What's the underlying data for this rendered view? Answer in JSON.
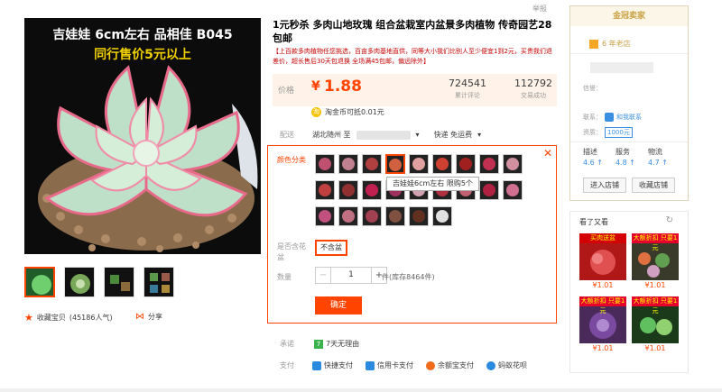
{
  "header": {
    "report": "举报"
  },
  "gallery": {
    "caption_line1": "吉娃娃 6cm左右 品相佳 B045",
    "caption_line2": "同行售价5元以上",
    "favorite_label": "收藏宝贝",
    "favorite_count": "(45186人气)",
    "share_label": "分享"
  },
  "product": {
    "title": "1元秒杀 多肉山地玫瑰 组合盆栽室内盆景多肉植物 传奇园艺28包邮",
    "subtitle": "【上百款多肉植物任您挑选，百亩多肉基地直供，同等大小我们比别人至少便宜1到2元，买贵我们退差价，超长售后30天包退换 全场满45包邮，偏远除外】",
    "price_label": "价格",
    "currency": "¥",
    "price": "1.88",
    "reviews_count": "724541",
    "reviews_label": "累计评论",
    "sales_count": "112792",
    "sales_label": "交易成功",
    "coin_icon": "淘",
    "coin_text": "淘金币可抵0.01元",
    "ship_label": "配送",
    "ship_from": "湖北随州 至",
    "ship_method": "快递 免运费",
    "color_label": "颜色分类",
    "tooltip": "吉娃娃6cm左右 限购5个",
    "pot_label": "是否含花盆",
    "pot_option": "不含盆",
    "qty_label": "数量",
    "qty_minus": "−",
    "qty_value": "1",
    "qty_plus": "+",
    "stock": "件(库存8464件)",
    "confirm": "确定",
    "promise_label": "承诺",
    "promise_icon": "7",
    "promise_text": "7天无理由",
    "pay_label": "支付",
    "pay_methods": [
      "快捷支付",
      "信用卡支付",
      "余额宝支付",
      "蚂蚁花呗"
    ]
  },
  "seller": {
    "badge": "金冠卖家",
    "years": "6 年老店",
    "credit_label": "信誉：",
    "contact_label": "联系：",
    "contact_text": "和我联系",
    "qual_label": "资质：",
    "qual_text": "1000元",
    "score_labels": [
      "描述",
      "服务",
      "物流"
    ],
    "score_values": [
      "4.6 ↑",
      "4.8 ↑",
      "4.7 ↑"
    ],
    "enter_shop": "进入店铺",
    "fav_shop": "收藏店铺"
  },
  "also_look": {
    "title": "看了又看",
    "refresh_icon": "↻",
    "items": [
      {
        "tag": "买肉送盆",
        "price": "¥1.01"
      },
      {
        "tag": "大额折扣 只要1元",
        "price": "¥1.01"
      },
      {
        "tag": "大额折扣 只要1元",
        "price": "¥1.01"
      },
      {
        "tag": "大额折扣 只要1元",
        "price": "¥1.01"
      }
    ]
  },
  "colors": {
    "accent": "#ff4400",
    "price": "#ff4400",
    "gold": "#c9a043"
  }
}
